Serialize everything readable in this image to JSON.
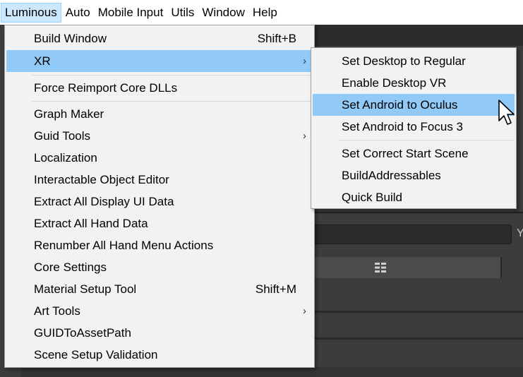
{
  "menubar": {
    "items": [
      "Luminous",
      "Auto",
      "Mobile Input",
      "Utils",
      "Window",
      "Help"
    ]
  },
  "main_menu": {
    "items": [
      {
        "label": "Build Window",
        "shortcut": "Shift+B"
      },
      {
        "label": "XR"
      },
      {
        "label": "Force Reimport Core DLLs"
      },
      {
        "label": "Graph Maker"
      },
      {
        "label": "Guid Tools"
      },
      {
        "label": "Localization"
      },
      {
        "label": "Interactable Object Editor"
      },
      {
        "label": "Extract All Display UI Data"
      },
      {
        "label": "Extract All Hand Data"
      },
      {
        "label": "Renumber All Hand Menu Actions"
      },
      {
        "label": "Core Settings"
      },
      {
        "label": "Material Setup Tool",
        "shortcut": "Shift+M"
      },
      {
        "label": "Art Tools"
      },
      {
        "label": "GUIDToAssetPath"
      },
      {
        "label": "Scene Setup Validation"
      }
    ]
  },
  "xr_submenu": {
    "items": [
      {
        "label": "Set Desktop to Regular"
      },
      {
        "label": "Enable Desktop VR"
      },
      {
        "label": "Set Android to Oculus"
      },
      {
        "label": "Set Android to Focus 3"
      },
      {
        "label": "Set Correct Start Scene"
      },
      {
        "label": "BuildAddressables"
      },
      {
        "label": "Quick Build"
      }
    ]
  },
  "background": {
    "field_cut_text": "Y"
  },
  "icons": {
    "submenu_arrow": "chevron-right-icon",
    "toolbar": "layout-icon",
    "cursor": "pointer-cursor-icon"
  },
  "colors": {
    "highlight": "#91c9f7",
    "menubar_active": "#cce8ff",
    "menu_bg": "#f2f2f2",
    "editor_bg": "#3c3c3c"
  }
}
